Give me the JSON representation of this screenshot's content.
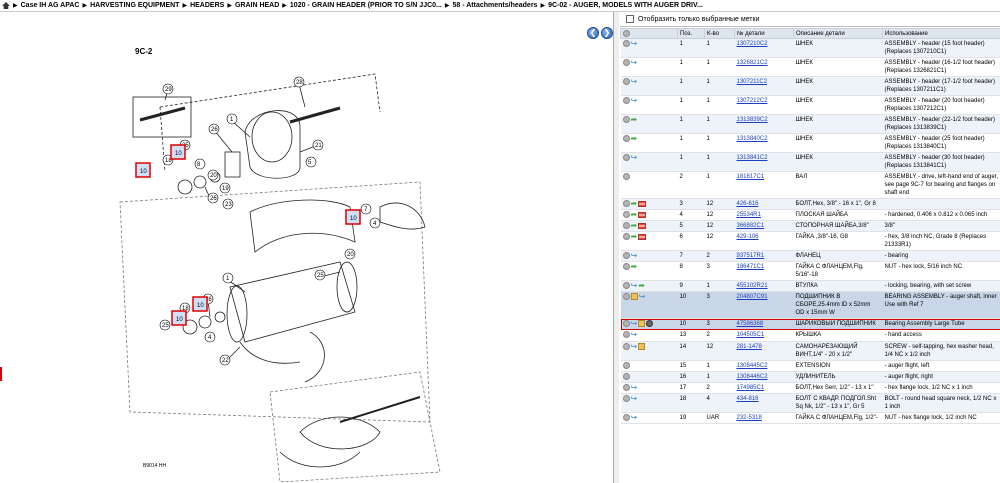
{
  "breadcrumb": {
    "items": [
      "Case IH AG APAC",
      "HARVESTING EQUIPMENT",
      "HEADERS",
      "GRAIN HEAD",
      "1020 - GRAIN HEADER (PRIOR TO S/N JJC0...",
      "58 - Attachments/headers",
      "9C-02 - AUGER, MODELS WITH AUGER DRIV..."
    ]
  },
  "diagram": {
    "title": "9C-2",
    "footer_code": "B9014 HH",
    "callouts": [
      "29",
      "28",
      "1",
      "26",
      "25",
      "21",
      "18",
      "10",
      "20",
      "8",
      "19",
      "5",
      "23",
      "25",
      "4",
      "7",
      "1",
      "25",
      "26",
      "10",
      "4",
      "18",
      "22",
      "20",
      "15",
      "16",
      "12",
      "13",
      "14"
    ]
  },
  "right_pane": {
    "filter_label": "Отобразить только выбранные метки",
    "columns": [
      "",
      "Поз.",
      "К-во",
      "№ детали",
      "Описание детали",
      "Использование"
    ],
    "rows": [
      {
        "pos": "1",
        "qty": "1",
        "part": "1307210C2",
        "desc": "ШНЕК",
        "usage": "ASSEMBLY - header (15 foot header) (Replaces 1307210C1)",
        "icons": [
          "gray",
          "arrow"
        ],
        "style": "alt"
      },
      {
        "pos": "1",
        "qty": "1",
        "part": "1326821C2",
        "desc": "ШНЕК",
        "usage": "ASSEMBLY - header (16-1/2 foot header) (Replaces 1326821C1)",
        "icons": [
          "gray",
          "arrow"
        ],
        "style": ""
      },
      {
        "pos": "1",
        "qty": "1",
        "part": "1307211C2",
        "desc": "ШНЕК",
        "usage": "ASSEMBLY - header (17-1/2 foot header) (Replaces 1307211C1)",
        "icons": [
          "gray",
          "arrow"
        ],
        "style": "alt"
      },
      {
        "pos": "1",
        "qty": "1",
        "part": "1307212C2",
        "desc": "ШНЕК",
        "usage": "ASSEMBLY - header (20 foot header) (Replaces 1307212C1)",
        "icons": [
          "gray",
          "arrow"
        ],
        "style": ""
      },
      {
        "pos": "1",
        "qty": "1",
        "part": "1313839C2",
        "desc": "ШНЕК",
        "usage": "ASSEMBLY - header (22-1/2 foot header) (Replaces 1313839C1)",
        "icons": [
          "gray",
          "green"
        ],
        "style": "alt"
      },
      {
        "pos": "1",
        "qty": "1",
        "part": "1313840C2",
        "desc": "ШНЕК",
        "usage": "ASSEMBLY - header (25 foot header) (Replaces 1313840C1)",
        "icons": [
          "gray",
          "green"
        ],
        "style": ""
      },
      {
        "pos": "1",
        "qty": "1",
        "part": "1313841C2",
        "desc": "ШНЕК",
        "usage": "ASSEMBLY - header (30 foot header) (Replaces 1313841C1)",
        "icons": [
          "gray",
          "arrow"
        ],
        "style": "alt"
      },
      {
        "pos": "2",
        "qty": "1",
        "part": "181817C1",
        "desc": "ВАЛ",
        "usage": "ASSEMBLY - drive, left-hand end of auger, see page 9C-7 for bearing and flanges on shaft end",
        "icons": [
          "gray"
        ],
        "style": ""
      },
      {
        "pos": "3",
        "qty": "12",
        "part": "426-616",
        "desc": "БОЛТ,Hex, 3/8\" - 16 x 1\", Gr 8",
        "usage": "",
        "icons": [
          "gray",
          "green",
          "flag"
        ],
        "style": "alt"
      },
      {
        "pos": "4",
        "qty": "12",
        "part": "25534R1",
        "desc": "ПЛОСКАЯ ШАЙБА",
        "usage": "- hardened, 0.406 x 0.812 x 0.065 inch",
        "icons": [
          "gray",
          "green",
          "flag"
        ],
        "style": ""
      },
      {
        "pos": "5",
        "qty": "12",
        "part": "366882C1",
        "desc": "СТОПОРНАЯ ШАЙБА,3/8\"",
        "usage": "3/8\"",
        "icons": [
          "gray",
          "green",
          "flag"
        ],
        "style": "alt"
      },
      {
        "pos": "6",
        "qty": "12",
        "part": "429-106",
        "desc": "ГАЙКА ,3/8\"-16, G8",
        "usage": "- hex, 3/8 inch NC, Grade 8 (Replaces 21333R1)",
        "icons": [
          "gray",
          "green",
          "flag"
        ],
        "style": ""
      },
      {
        "pos": "7",
        "qty": "2",
        "part": "937517R1",
        "desc": "ФЛАНЕЦ",
        "usage": "- bearing",
        "icons": [
          "gray",
          "arrow"
        ],
        "style": "alt"
      },
      {
        "pos": "8",
        "qty": "3",
        "part": "186471C1",
        "desc": "ГАЙКА С ФЛАНЦЕМ,Flg, 5/16\"-18",
        "usage": "NUT - hex lock, 5/16 inch NC",
        "icons": [
          "gray",
          "green"
        ],
        "style": ""
      },
      {
        "pos": "9",
        "qty": "1",
        "part": "455102R21",
        "desc": "ВТУЛКА",
        "usage": "- locking, bearing, with set screw",
        "icons": [
          "gray",
          "arrow",
          "green"
        ],
        "style": "alt"
      },
      {
        "pos": "10",
        "qty": "3",
        "part": "204807C91",
        "desc": "ПОДШИПНИК В СБОРЕ,25.4mm ID x 52mm OD x 15mm W",
        "usage": "BEARING ASSEMBLY - auger shaft, inner Use with Ref 7",
        "icons": [
          "gray",
          "box",
          "arrow"
        ],
        "style": "sel"
      },
      {
        "pos": "10",
        "qty": "3",
        "part": "47586368",
        "desc": "ШАРИКОВЫЙ ПОДШИПНИК",
        "usage": "Bearing Assembly Large Tube",
        "icons": [
          "gray",
          "arrow",
          "box",
          "gear"
        ],
        "style": "hl"
      },
      {
        "pos": "13",
        "qty": "2",
        "part": "104505C1",
        "desc": "КРЫШКА",
        "usage": "- hand access",
        "icons": [
          "gray",
          "arrow"
        ],
        "style": ""
      },
      {
        "pos": "14",
        "qty": "12",
        "part": "281-1478",
        "desc": "САМОНАРЕЗАЮЩИЙ ВИНТ,1/4\" - 20 x 1/2\"",
        "usage": "SCREW - self-tapping, hex washer head, 1/4 NC x 1/2 inch",
        "icons": [
          "gray",
          "arrow",
          "box"
        ],
        "style": "alt"
      },
      {
        "pos": "15",
        "qty": "1",
        "part": "1308445C2",
        "desc": "EXTENSION",
        "usage": "- auger flight, left",
        "icons": [
          "gray"
        ],
        "style": ""
      },
      {
        "pos": "16",
        "qty": "1",
        "part": "1308446C2",
        "desc": "УДЛИНИТЕЛЬ",
        "usage": "- auger flight, right",
        "icons": [
          "gray"
        ],
        "style": "alt"
      },
      {
        "pos": "17",
        "qty": "2",
        "part": "174985C1",
        "desc": "БОЛТ,Hex Serr, 1/2\" - 13 x 1\"",
        "usage": "- hex flange lock, 1/2 NC x 1 inch",
        "icons": [
          "gray",
          "arrow"
        ],
        "style": ""
      },
      {
        "pos": "18",
        "qty": "4",
        "part": "434-816",
        "desc": "БОЛТ С КВАДР. ПОДГОЛ.Sht Sq Nk, 1/2\" - 13 x 1\", Gr 5",
        "usage": "BOLT - round head square neck, 1/2 NC x 1 inch",
        "icons": [
          "gray",
          "arrow"
        ],
        "style": "alt"
      },
      {
        "pos": "19",
        "qty": "UAR",
        "part": "232-5318",
        "desc": "ГАЙКА С ФЛАНЦЕМ,Flg, 1/2\"-",
        "usage": "NUT - hex flange lock, 1/2 inch NC",
        "icons": [
          "gray",
          "arrow"
        ],
        "style": ""
      }
    ]
  }
}
